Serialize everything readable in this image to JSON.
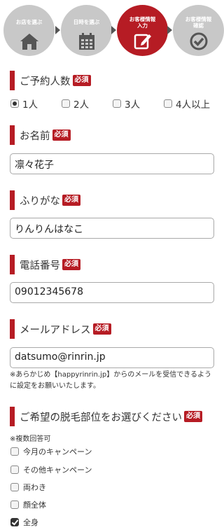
{
  "steps": [
    {
      "label": "お店を選ぶ",
      "icon": "house-icon"
    },
    {
      "label": "日時を選ぶ",
      "icon": "calendar-icon"
    },
    {
      "label": "お客様情報\n入力",
      "icon": "edit-icon",
      "active": true
    },
    {
      "label": "お客様情報\n確認",
      "icon": "check-circle-icon"
    }
  ],
  "required_badge": "必須",
  "party_size": {
    "title": "ご予約人数",
    "options": [
      "1人",
      "2人",
      "3人",
      "4人以上"
    ],
    "selected": "1人"
  },
  "name": {
    "title": "お名前",
    "value": "凛々花子"
  },
  "furigana": {
    "title": "ふりがな",
    "value": "りんりんはなこ"
  },
  "phone": {
    "title": "電話番号",
    "value": "09012345678"
  },
  "email": {
    "title": "メールアドレス",
    "value": "datsumo@rinrin.jp",
    "note": "※あらかじめ【happyrinrin.jp】からのメールを受信できるように設定をお願いいたします。"
  },
  "areas": {
    "title": "ご希望の脱毛部位をお選びください",
    "note": "※複数回答可",
    "options": [
      {
        "label": "今月のキャンペーン",
        "checked": false
      },
      {
        "label": "その他キャンペーン",
        "checked": false
      },
      {
        "label": "両わき",
        "checked": false
      },
      {
        "label": "顔全体",
        "checked": false
      },
      {
        "label": "全身",
        "checked": true
      }
    ]
  },
  "colors": {
    "accent": "#b61c24",
    "step_inactive": "#c8c8c8"
  }
}
